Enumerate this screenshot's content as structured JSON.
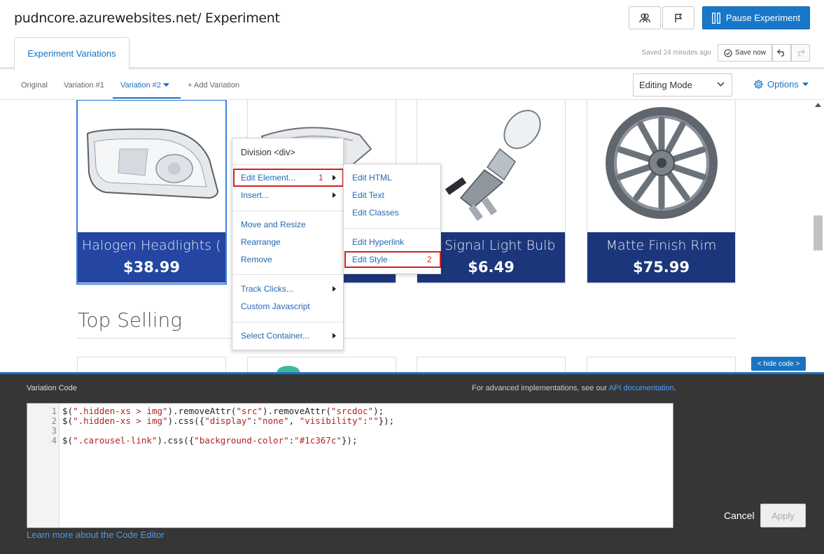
{
  "header": {
    "title": "pudncore.azurewebsites.net/ Experiment",
    "pause_label": "Pause Experiment",
    "tab_label": "Experiment Variations",
    "saved_text": "Saved 24 minutes ago",
    "save_now_label": "Save now"
  },
  "variations": {
    "tabs": [
      "Original",
      "Variation #1",
      "Variation #2",
      "+ Add Variation"
    ],
    "active_index": 2,
    "mode_value": "Editing Mode",
    "options_label": "Options"
  },
  "products": [
    {
      "name": "Halogen Headlights (...",
      "price": "$38.99"
    },
    {
      "name": "",
      "price": ""
    },
    {
      "name": "rn Signal Light Bulb",
      "price": "$6.49"
    },
    {
      "name": "Matte Finish Rim",
      "price": "$75.99"
    }
  ],
  "section_title": "Top Selling",
  "hide_code_label": "< hide code >",
  "context_menu": {
    "heading": "Division <div>",
    "items": [
      "Edit Element...",
      "Insert...",
      "Move and Resize",
      "Rearrange",
      "Remove",
      "Track Clicks...",
      "Custom Javascript",
      "Select Container..."
    ],
    "marker": "1"
  },
  "submenu": {
    "items": [
      "Edit HTML",
      "Edit Text",
      "Edit Classes",
      "Edit Hyperlink",
      "Edit Style"
    ],
    "marker": "2"
  },
  "code_panel": {
    "label": "Variation Code",
    "advanced_text": "For advanced implementations, see our",
    "api_link": "API documentation",
    "advanced_suffix": ".",
    "line_numbers": [
      "1",
      "2",
      "3",
      "4"
    ],
    "learn_more": "Learn more about the Code Editor",
    "cancel_label": "Cancel",
    "apply_label": "Apply"
  },
  "colors": {
    "accent": "#1a73c0",
    "product_label": "#1c367c",
    "highlight": "#d61f1f",
    "panel": "#363636"
  }
}
